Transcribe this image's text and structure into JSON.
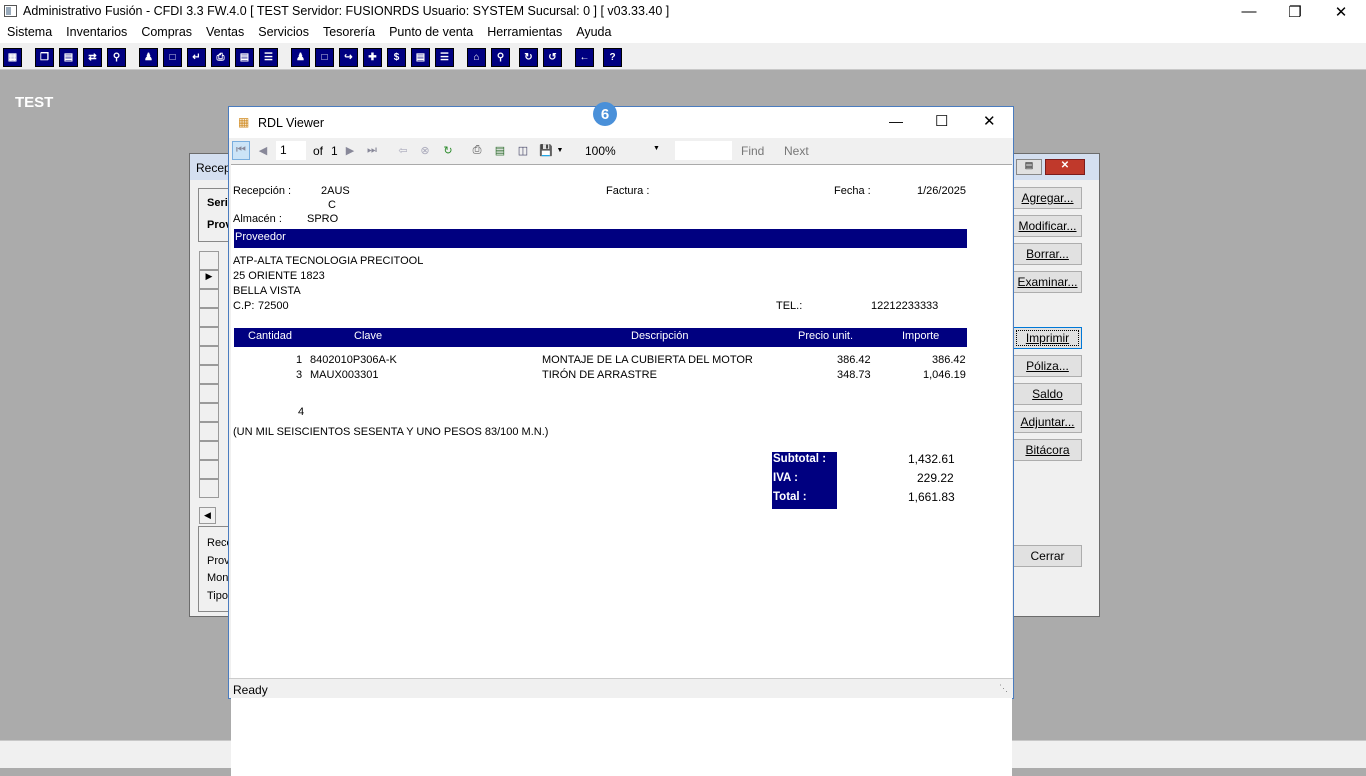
{
  "app": {
    "title": "Administrativo Fusión - CFDI 3.3 FW.4.0 [ TEST   Servidor: FUSIONRDS    Usuario: SYSTEM     Sucursal: 0 ] [ v03.33.40 ]",
    "company_label": "TEST"
  },
  "menu": [
    "Sistema",
    "Inventarios",
    "Compras",
    "Ventas",
    "Servicios",
    "Tesorería",
    "Punto de venta",
    "Herramientas",
    "Ayuda"
  ],
  "background_form": {
    "title": "Recep",
    "labels": [
      "Seri",
      "Prov"
    ],
    "footer_labels": [
      "Rece",
      "Prov",
      "Mone",
      "Tipo"
    ],
    "buttons": [
      "Agregar...",
      "Modificar...",
      "Borrar...",
      "Examinar...",
      "Imprimir",
      "Póliza...",
      "Saldo",
      "Adjuntar...",
      "Bitácora",
      "Cerrar"
    ]
  },
  "badge": "6",
  "viewer": {
    "title": "RDL Viewer",
    "page_current": "1",
    "page_of": "of",
    "page_total": "1",
    "zoom": "100%",
    "find_label": "Find",
    "next_label": "Next",
    "status": "Ready"
  },
  "report": {
    "recepcion_label": "Recepción :",
    "recepcion_value": "2AUS",
    "recepcion_value2": "C",
    "factura_label": "Factura :",
    "fecha_label": "Fecha :",
    "fecha_value": "1/26/2025",
    "almacen_label": "Almacén :",
    "almacen_value": "SPRO",
    "proveedor_header": "Proveedor",
    "prov_name": "ATP-ALTA TECNOLOGIA PRECITOOL",
    "prov_addr1": "25 ORIENTE 1823",
    "prov_addr2": "BELLA VISTA",
    "prov_cp_label": "C.P:",
    "prov_cp": "72500",
    "tel_label": "TEL.:",
    "tel_value": "12212233333",
    "columns": {
      "cantidad": "Cantidad",
      "clave": "Clave",
      "descripcion": "Descripción",
      "precio": "Precio unit.",
      "importe": "Importe"
    },
    "rows": [
      {
        "cantidad": "1",
        "clave": "8402010P306A-K",
        "descripcion": "MONTAJE DE LA CUBIERTA DEL MOTOR",
        "precio": "386.42",
        "importe": "386.42"
      },
      {
        "cantidad": "3",
        "clave": "MAUX003301",
        "descripcion": "TIRÓN DE ARRASTRE",
        "precio": "348.73",
        "importe": "1,046.19"
      }
    ],
    "total_qty": "4",
    "amount_words": "(UN MIL SEISCIENTOS SESENTA Y UNO PESOS 83/100 M.N.)",
    "subtotal_label": "Subtotal :",
    "subtotal_value": "1,432.61",
    "iva_label": "IVA :",
    "iva_value": "229.22",
    "total_label": "Total :",
    "total_value": "1,661.83"
  }
}
